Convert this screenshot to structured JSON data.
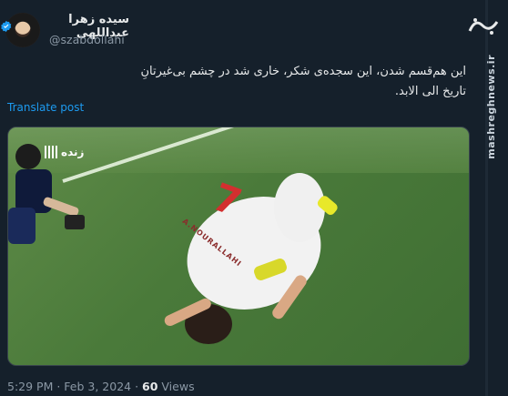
{
  "tweet": {
    "display_name": "سیده زهرا عبداللهی",
    "handle": "@szabdollahi",
    "body": "این هم‌قسم شدن، این سجده‌ی شکر، خاری شد در چشم بی‌غیرتانِ تاریخ الی الابد.",
    "translate_label": "Translate post",
    "timestamp": "5:29 PM · Feb 3, 2024 · ",
    "views_count": "60",
    "views_label": " Views"
  },
  "media": {
    "live_label": "زنده",
    "jersey_number": "7",
    "jersey_name": "A.NOURALLAHI"
  },
  "watermark": {
    "site": "mashreghnews.ir",
    "logo_text": "مشرق"
  },
  "colors": {
    "background": "#15202b",
    "link": "#1d9bf0",
    "verified": "#1d9bf0",
    "muted": "#8b98a5"
  }
}
